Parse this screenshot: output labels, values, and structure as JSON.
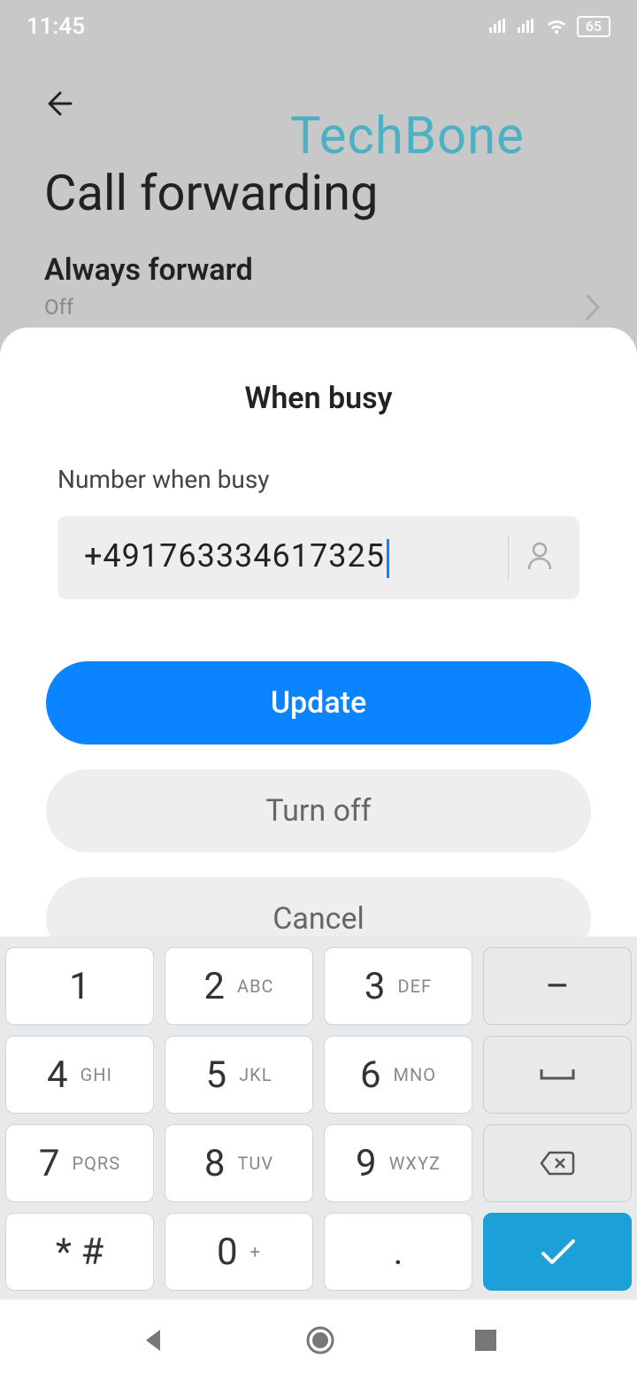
{
  "status": {
    "time": "11:45",
    "battery": "65"
  },
  "watermark": "TechBone",
  "page": {
    "title": "Call forwarding"
  },
  "row": {
    "always_label": "Always forward",
    "always_value": "Off"
  },
  "sheet": {
    "title": "When busy",
    "field_label": "Number when busy",
    "phone_value": "+491763334617325",
    "update_label": "Update",
    "turnoff_label": "Turn off",
    "cancel_label": "Cancel"
  },
  "keys": {
    "k1": "1",
    "k2": "2",
    "k2l": "ABC",
    "k3": "3",
    "k3l": "DEF",
    "k4": "4",
    "k4l": "GHI",
    "k5": "5",
    "k5l": "JKL",
    "k6": "6",
    "k6l": "MNO",
    "k7": "7",
    "k7l": "PQRS",
    "k8": "8",
    "k8l": "TUV",
    "k9": "9",
    "k9l": "WXYZ",
    "kstar": "* #",
    "k0": "0",
    "k0l": "+",
    "kdot": ".",
    "kdash": "–"
  }
}
